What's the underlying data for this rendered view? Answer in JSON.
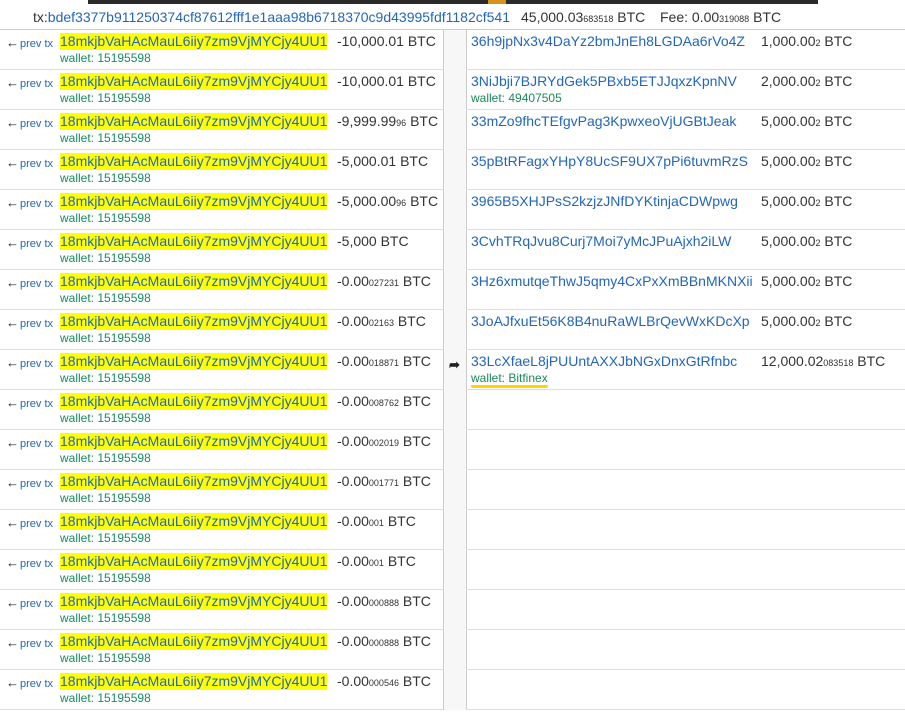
{
  "header": {
    "tx_prefix": "tx:",
    "tx_id": "bdef3377b911250374cf87612fff1e1aaa98b6718370c9d43995fdf1182cf541",
    "total_main": "45,000.03",
    "total_small": "683518",
    "total_unit": "BTC",
    "fee_label": "Fee: 0.00",
    "fee_small": "319088",
    "fee_unit": "BTC"
  },
  "prev_tx_label": "prev tx",
  "inputs": [
    {
      "address": "18mkjbVaHAcMauL6iiy7zm9VjMYCjy4UU1",
      "wallet": "wallet: 15195598",
      "amount_main": "-10,000.01",
      "amount_small": "",
      "unit": "BTC"
    },
    {
      "address": "18mkjbVaHAcMauL6iiy7zm9VjMYCjy4UU1",
      "wallet": "wallet: 15195598",
      "amount_main": "-10,000.01",
      "amount_small": "",
      "unit": "BTC"
    },
    {
      "address": "18mkjbVaHAcMauL6iiy7zm9VjMYCjy4UU1",
      "wallet": "wallet: 15195598",
      "amount_main": "-9,999.99",
      "amount_small": "96",
      "unit": "BTC"
    },
    {
      "address": "18mkjbVaHAcMauL6iiy7zm9VjMYCjy4UU1",
      "wallet": "wallet: 15195598",
      "amount_main": "-5,000.01",
      "amount_small": "",
      "unit": "BTC"
    },
    {
      "address": "18mkjbVaHAcMauL6iiy7zm9VjMYCjy4UU1",
      "wallet": "wallet: 15195598",
      "amount_main": "-5,000.00",
      "amount_small": "96",
      "unit": "BTC"
    },
    {
      "address": "18mkjbVaHAcMauL6iiy7zm9VjMYCjy4UU1",
      "wallet": "wallet: 15195598",
      "amount_main": "-5,000",
      "amount_small": "",
      "unit": "BTC"
    },
    {
      "address": "18mkjbVaHAcMauL6iiy7zm9VjMYCjy4UU1",
      "wallet": "wallet: 15195598",
      "amount_main": "-0.00",
      "amount_small": "027231",
      "unit": "BTC"
    },
    {
      "address": "18mkjbVaHAcMauL6iiy7zm9VjMYCjy4UU1",
      "wallet": "wallet: 15195598",
      "amount_main": "-0.00",
      "amount_small": "02163",
      "unit": "BTC"
    },
    {
      "address": "18mkjbVaHAcMauL6iiy7zm9VjMYCjy4UU1",
      "wallet": "wallet: 15195598",
      "amount_main": "-0.00",
      "amount_small": "018871",
      "unit": "BTC"
    },
    {
      "address": "18mkjbVaHAcMauL6iiy7zm9VjMYCjy4UU1",
      "wallet": "wallet: 15195598",
      "amount_main": "-0.00",
      "amount_small": "008762",
      "unit": "BTC"
    },
    {
      "address": "18mkjbVaHAcMauL6iiy7zm9VjMYCjy4UU1",
      "wallet": "wallet: 15195598",
      "amount_main": "-0.00",
      "amount_small": "002019",
      "unit": "BTC"
    },
    {
      "address": "18mkjbVaHAcMauL6iiy7zm9VjMYCjy4UU1",
      "wallet": "wallet: 15195598",
      "amount_main": "-0.00",
      "amount_small": "001771",
      "unit": "BTC"
    },
    {
      "address": "18mkjbVaHAcMauL6iiy7zm9VjMYCjy4UU1",
      "wallet": "wallet: 15195598",
      "amount_main": "-0.00",
      "amount_small": "001",
      "unit": "BTC"
    },
    {
      "address": "18mkjbVaHAcMauL6iiy7zm9VjMYCjy4UU1",
      "wallet": "wallet: 15195598",
      "amount_main": "-0.00",
      "amount_small": "001",
      "unit": "BTC"
    },
    {
      "address": "18mkjbVaHAcMauL6iiy7zm9VjMYCjy4UU1",
      "wallet": "wallet: 15195598",
      "amount_main": "-0.00",
      "amount_small": "000888",
      "unit": "BTC"
    },
    {
      "address": "18mkjbVaHAcMauL6iiy7zm9VjMYCjy4UU1",
      "wallet": "wallet: 15195598",
      "amount_main": "-0.00",
      "amount_small": "000888",
      "unit": "BTC"
    },
    {
      "address": "18mkjbVaHAcMauL6iiy7zm9VjMYCjy4UU1",
      "wallet": "wallet: 15195598",
      "amount_main": "-0.00",
      "amount_small": "000546",
      "unit": "BTC"
    }
  ],
  "outputs": [
    {
      "address": "36h9jpNx3v4DaYz2bmJnEh8LGDAa6rVo4Z",
      "wallet": "",
      "amount_main": "1,000.00",
      "amount_small": "2",
      "unit": "BTC"
    },
    {
      "address": "3NiJbji7BJRYdGek5PBxb5ETJJqxzKpnNV",
      "wallet": "wallet: 49407505",
      "amount_main": "2,000.00",
      "amount_small": "2",
      "unit": "BTC"
    },
    {
      "address": "33mZo9fhcTEfgvPag3KpwxeoVjUGBtJeak",
      "wallet": "",
      "amount_main": "5,000.00",
      "amount_small": "2",
      "unit": "BTC"
    },
    {
      "address": "35pBtRFagxYHpY8UcSF9UX7pPi6tuvmRzS",
      "wallet": "",
      "amount_main": "5,000.00",
      "amount_small": "2",
      "unit": "BTC"
    },
    {
      "address": "3965B5XHJPsS2kzjzJNfDYKtinjaCDWpwg",
      "wallet": "",
      "amount_main": "5,000.00",
      "amount_small": "2",
      "unit": "BTC"
    },
    {
      "address": "3CvhTRqJvu8Curj7Moi7yMcJPuAjxh2iLW",
      "wallet": "",
      "amount_main": "5,000.00",
      "amount_small": "2",
      "unit": "BTC"
    },
    {
      "address": "3Hz6xmutqeThwJ5qmy4CxPxXmBBnMKNXii",
      "wallet": "",
      "amount_main": "5,000.00",
      "amount_small": "2",
      "unit": "BTC"
    },
    {
      "address": "3JoAJfxuEt56K8B4nuRaWLBrQevWxKDcXp",
      "wallet": "",
      "amount_main": "5,000.00",
      "amount_small": "2",
      "unit": "BTC"
    },
    {
      "address": "33LcXfaeL8jPUUntAXXJbNGxDnxGtRfnbc",
      "wallet": "wallet: Bitfinex",
      "amount_main": "12,000.02",
      "amount_small": "083518",
      "unit": "BTC"
    }
  ],
  "colors": {
    "link": "#2266bb",
    "wallet": "#1a8a5a",
    "highlight": "#ffff00",
    "bitfinex_underline": "#ffd400"
  },
  "icons": {
    "prev": "arrow-left-icon",
    "flow": "arrow-right-icon"
  }
}
